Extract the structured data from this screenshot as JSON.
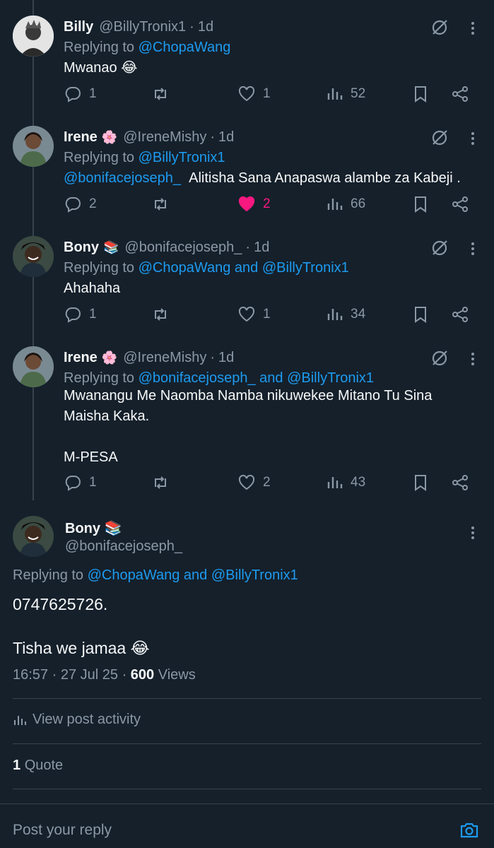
{
  "replies": [
    {
      "name": "Billy",
      "emoji": "",
      "handle": "@BillyTronix1",
      "time": "1d",
      "replying_prefix": "Replying to ",
      "replying_to": "@ChopaWang",
      "replying_and": "",
      "replying_to2": "",
      "mention": "",
      "text": "Mwanao 😂",
      "comments": "1",
      "retweets": "",
      "likes": "1",
      "views": "52",
      "liked": false
    },
    {
      "name": "Irene",
      "emoji": "🌸",
      "handle": "@IreneMishy",
      "time": "1d",
      "replying_prefix": "Replying to ",
      "replying_to": "@BillyTronix1",
      "replying_and": "",
      "replying_to2": "",
      "mention": "@bonifacejoseph_",
      "text": "Alitisha Sana Anapaswa alambe za Kabeji .",
      "comments": "2",
      "retweets": "",
      "likes": "2",
      "views": "66",
      "liked": true
    },
    {
      "name": "Bony",
      "emoji": "📚",
      "handle": "@bonifacejoseph_",
      "time": "1d",
      "replying_prefix": "Replying to ",
      "replying_to": "@ChopaWang",
      "replying_and": " and ",
      "replying_to2": "@BillyTronix1",
      "mention": "",
      "text": "Ahahaha",
      "comments": "1",
      "retweets": "",
      "likes": "1",
      "views": "34",
      "liked": false
    },
    {
      "name": "Irene",
      "emoji": "🌸",
      "handle": "@IreneMishy",
      "time": "1d",
      "replying_prefix": "Replying to ",
      "replying_to": "@bonifacejoseph_",
      "replying_and": " and ",
      "replying_to2": "@BillyTronix1",
      "mention": "",
      "text": "Mwanangu Me Naomba Namba nikuwekee Mitano Tu Sina\nMaisha Kaka.\n\nM-PESA",
      "comments": "1",
      "retweets": "",
      "likes": "2",
      "views": "43",
      "liked": false
    }
  ],
  "main": {
    "name": "Bony",
    "emoji": "📚",
    "handle": "@bonifacejoseph_",
    "replying_prefix": "Replying to ",
    "replying_to": "@ChopaWang",
    "replying_and": " and ",
    "replying_to2": "@BillyTronix1",
    "text": "0747625726.\n\nTisha we jamaa 😂",
    "time": "16:57",
    "date": "27 Jul 25",
    "views_count": "600",
    "views_label": "Views",
    "activity_label": "View post activity",
    "quote_count": "1",
    "quote_label": "Quote"
  },
  "reply_box": {
    "placeholder": "Post your reply"
  },
  "colors": {
    "background": "#15202b",
    "accent": "#1d9bf0",
    "like": "#f91880",
    "muted": "#8b98a5"
  },
  "icons": [
    "comment-icon",
    "retweet-icon",
    "heart-icon",
    "views-icon",
    "bookmark-icon",
    "share-icon",
    "grok-icon",
    "more-icon",
    "camera-icon"
  ]
}
